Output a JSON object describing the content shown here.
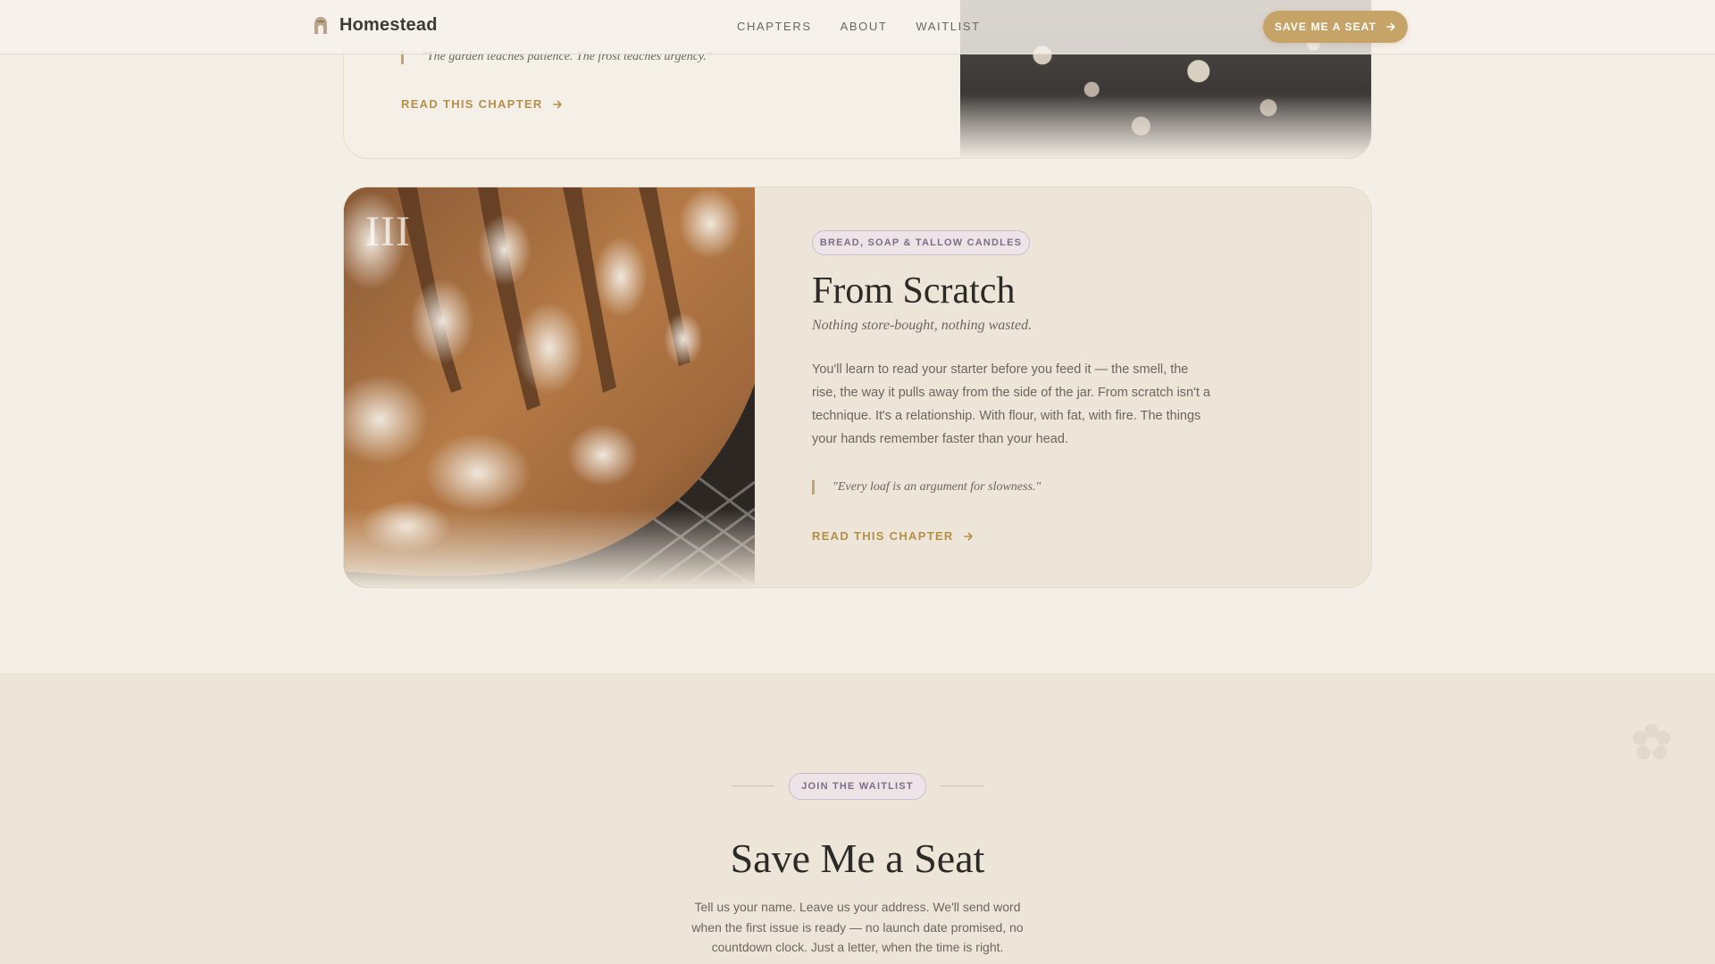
{
  "header": {
    "brand": "Homestead",
    "nav": [
      "CHAPTERS",
      "ABOUT",
      "WAITLIST"
    ],
    "cta_label": "SAVE ME A SEAT"
  },
  "previous_chapter": {
    "quote": "\"The garden teaches patience. The frost teaches urgency.\"",
    "link_label": "READ THIS CHAPTER"
  },
  "chapter": {
    "numeral": "III",
    "tag": "BREAD, SOAP & TALLOW CANDLES",
    "title": "From Scratch",
    "subtitle": "Nothing store-bought, nothing wasted.",
    "body": "You'll learn to read your starter before you feed it — the smell, the rise, the way it pulls away from the side of the jar. From scratch isn't a technique. It's a relationship. With flour, with fat, with fire. The things your hands remember faster than your head.",
    "quote": "\"Every loaf is an argument for slowness.\"",
    "link_label": "READ THIS CHAPTER"
  },
  "waitlist": {
    "eyebrow": "JOIN THE WAITLIST",
    "title": "Save Me a Seat",
    "text": "Tell us your name. Leave us your address. We'll send word when the first issue is ready — no launch date promised, no countdown clock. Just a letter, when the time is right."
  },
  "colors": {
    "background": "#f4efe6",
    "accent": "#c6a468",
    "link": "#b48f4c",
    "tag_text": "#7d6f86"
  }
}
